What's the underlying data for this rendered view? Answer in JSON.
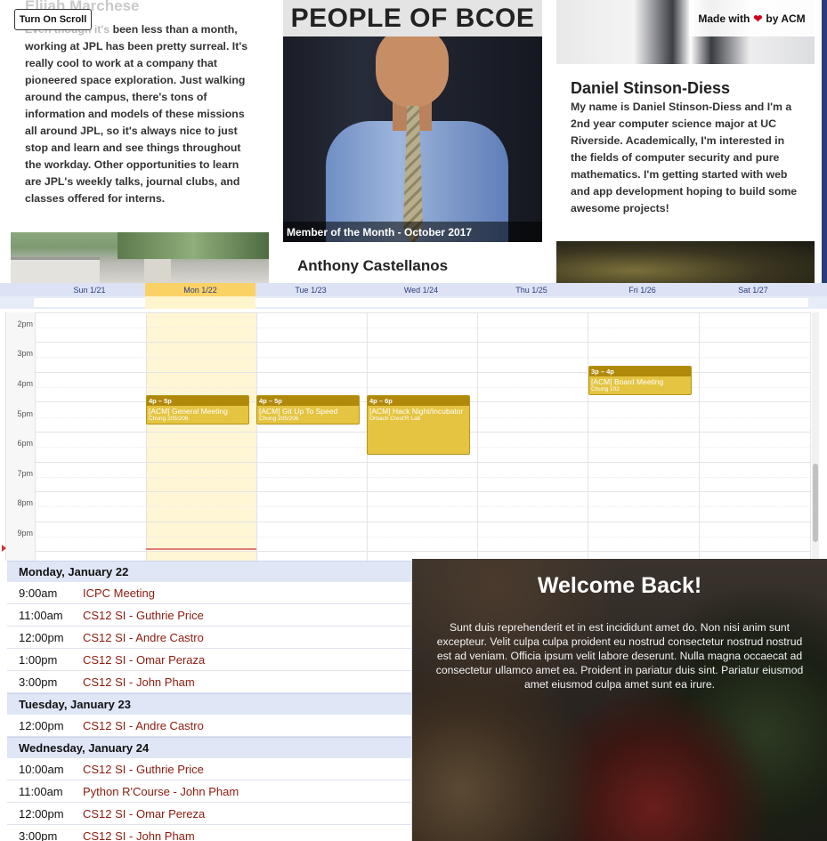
{
  "controls": {
    "scroll_button": "Turn On Scroll"
  },
  "people": {
    "left": {
      "name": "Elijah Marchese",
      "bio_faded": "Even though it's",
      "bio": "been less than a month, working at JPL has been pretty surreal. It's really cool to work at a company that pioneered space exploration. Just walking around the campus, there's tons of information and models of these missions all around JPL, so it's always nice to just stop and learn and see things throughout the workday. Other opportunities to learn are JPL's weekly talks, journal clubs, and classes offered for interns."
    },
    "middle": {
      "title": "PEOPLE OF BCOE",
      "caption": "Member of the Month - October 2017",
      "name": "Anthony Castellanos"
    },
    "right": {
      "made_with_prefix": "Made with",
      "made_with_suffix": "by ACM",
      "name": "Daniel Stinson-Diess",
      "bio": "My name is Daniel Stinson-Diess and I'm a 2nd year computer science major at UC Riverside. Academically, I'm interested in the fields of computer security and pure mathematics. I'm getting started with web and app development hoping to build some awesome projects!"
    }
  },
  "calendar": {
    "days": [
      "Sun 1/21",
      "Mon 1/22",
      "Tue 1/23",
      "Wed 1/24",
      "Thu 1/25",
      "Fri 1/26",
      "Sat 1/27"
    ],
    "today": "Mon 1/22",
    "hours": [
      "2pm",
      "3pm",
      "4pm",
      "5pm",
      "6pm",
      "7pm",
      "8pm",
      "9pm"
    ],
    "events": [
      {
        "day": "Mon 1/22",
        "time": "4p – 5p",
        "title": "[ACM] General Meeting",
        "location": "Chung 205/206",
        "start": 16,
        "end": 17
      },
      {
        "day": "Tue 1/23",
        "time": "4p – 5p",
        "title": "[ACM] Git Up To Speed",
        "location": "Chung 205/206",
        "start": 16,
        "end": 17
      },
      {
        "day": "Wed 1/24",
        "time": "4p – 6p",
        "title": "[ACM] Hack Night/Incubator",
        "location": "Orbach Crest'R Lab",
        "start": 16,
        "end": 18
      },
      {
        "day": "Fri 1/26",
        "time": "3p – 4p",
        "title": "[ACM] Board Meeting",
        "location": "Chung 102",
        "start": 15,
        "end": 16
      }
    ]
  },
  "agenda": [
    {
      "date": "Monday, January 22",
      "items": [
        {
          "time": "9:00am",
          "title": "ICPC Meeting"
        },
        {
          "time": "11:00am",
          "title": "CS12 SI - Guthrie Price"
        },
        {
          "time": "12:00pm",
          "title": "CS12 SI - Andre Castro"
        },
        {
          "time": "1:00pm",
          "title": "CS12 SI - Omar Peraza"
        },
        {
          "time": "3:00pm",
          "title": "CS12 SI - John Pham"
        }
      ]
    },
    {
      "date": "Tuesday, January 23",
      "items": [
        {
          "time": "12:00pm",
          "title": "CS12 SI - Andre Castro"
        }
      ]
    },
    {
      "date": "Wednesday, January 24",
      "items": [
        {
          "time": "10:00am",
          "title": "CS12 SI - Guthrie Price"
        },
        {
          "time": "11:00am",
          "title": "Python R'Course - John Pham"
        },
        {
          "time": "12:00pm",
          "title": "CS12 SI - Omar Pereza"
        },
        {
          "time": "3:00pm",
          "title": "CS12 SI - John Pham"
        }
      ]
    }
  ],
  "welcome": {
    "title": "Welcome Back!",
    "text": "Sunt duis reprehenderit et in est incididunt amet do. Non nisi anim sunt excepteur. Velit culpa culpa proident eu nostrud consectetur nostrud nostrud est ad veniam. Officia ipsum velit labore deserunt. Nulla magna occaecat ad consectetur ullamco amet ea. Proident in pariatur duis sint. Pariatur eiusmod amet eiusmod culpa amet sunt ea irure."
  },
  "colors": {
    "event_fill": "#e4c441",
    "event_header": "#b0890b",
    "today_fill": "#fff6d5",
    "agenda_link": "#8b1b10",
    "heart": "#d0021b"
  }
}
